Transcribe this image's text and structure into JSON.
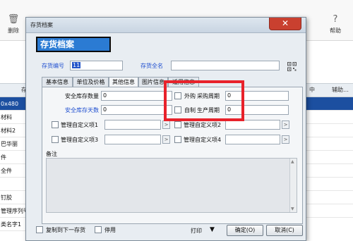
{
  "background": {
    "toolbar": {
      "delete_label": "删除",
      "help_label": "帮助",
      "delete_icon": "trash-icon",
      "help_icon": "question-icon"
    },
    "grid": {
      "header_left": "存",
      "header_right_1": "中",
      "header_right_2": "辅助…",
      "rows": [
        "0x480",
        "材料",
        "材料2",
        "巴华丽",
        "件",
        "全件",
        "",
        "钉胶",
        "管理序列号",
        "类名字1"
      ]
    }
  },
  "dialog": {
    "title": "存货档案",
    "close_icon": "close-icon",
    "header_badge": "存货档案",
    "code_label": "存货编号",
    "code_value": "11",
    "fullname_label": "存货全名",
    "fullname_value": "",
    "qr_icon": "qr-code-icon",
    "tabs": [
      {
        "label": "基本信息"
      },
      {
        "label": "单位及价格"
      },
      {
        "label": "其他信息"
      },
      {
        "label": "图片信息"
      },
      {
        "label": "适用信息"
      }
    ],
    "safety_stock_label": "安全库存数量",
    "safety_stock_value": "0",
    "safety_days_label": "安全库存天数",
    "safety_days_value": "0",
    "outsourced_label": "外购",
    "purchase_period_label": "采购周期",
    "purchase_period_value": "0",
    "selfmade_label": "自制",
    "production_period_label": "生产周期",
    "production_period_value": "0",
    "custom1_label": "管理自定义项1",
    "custom2_label": "管理自定义项2",
    "custom3_label": "管理自定义项3",
    "custom4_label": "管理自定义项4",
    "custom_btn_glyph": ">",
    "notes_label": "备注",
    "copy_next_label": "复制到下一存货",
    "disable_label": "停用",
    "print_label": "打印",
    "print_arrow": "▼",
    "ok_label": "确定(O)",
    "cancel_label": "取消(C)"
  },
  "colors": {
    "badge_bg": "#2b7bd3",
    "highlight": "#e8222b",
    "close_bg": "#c9402f",
    "field_label_blue": "#1f4fd0"
  }
}
